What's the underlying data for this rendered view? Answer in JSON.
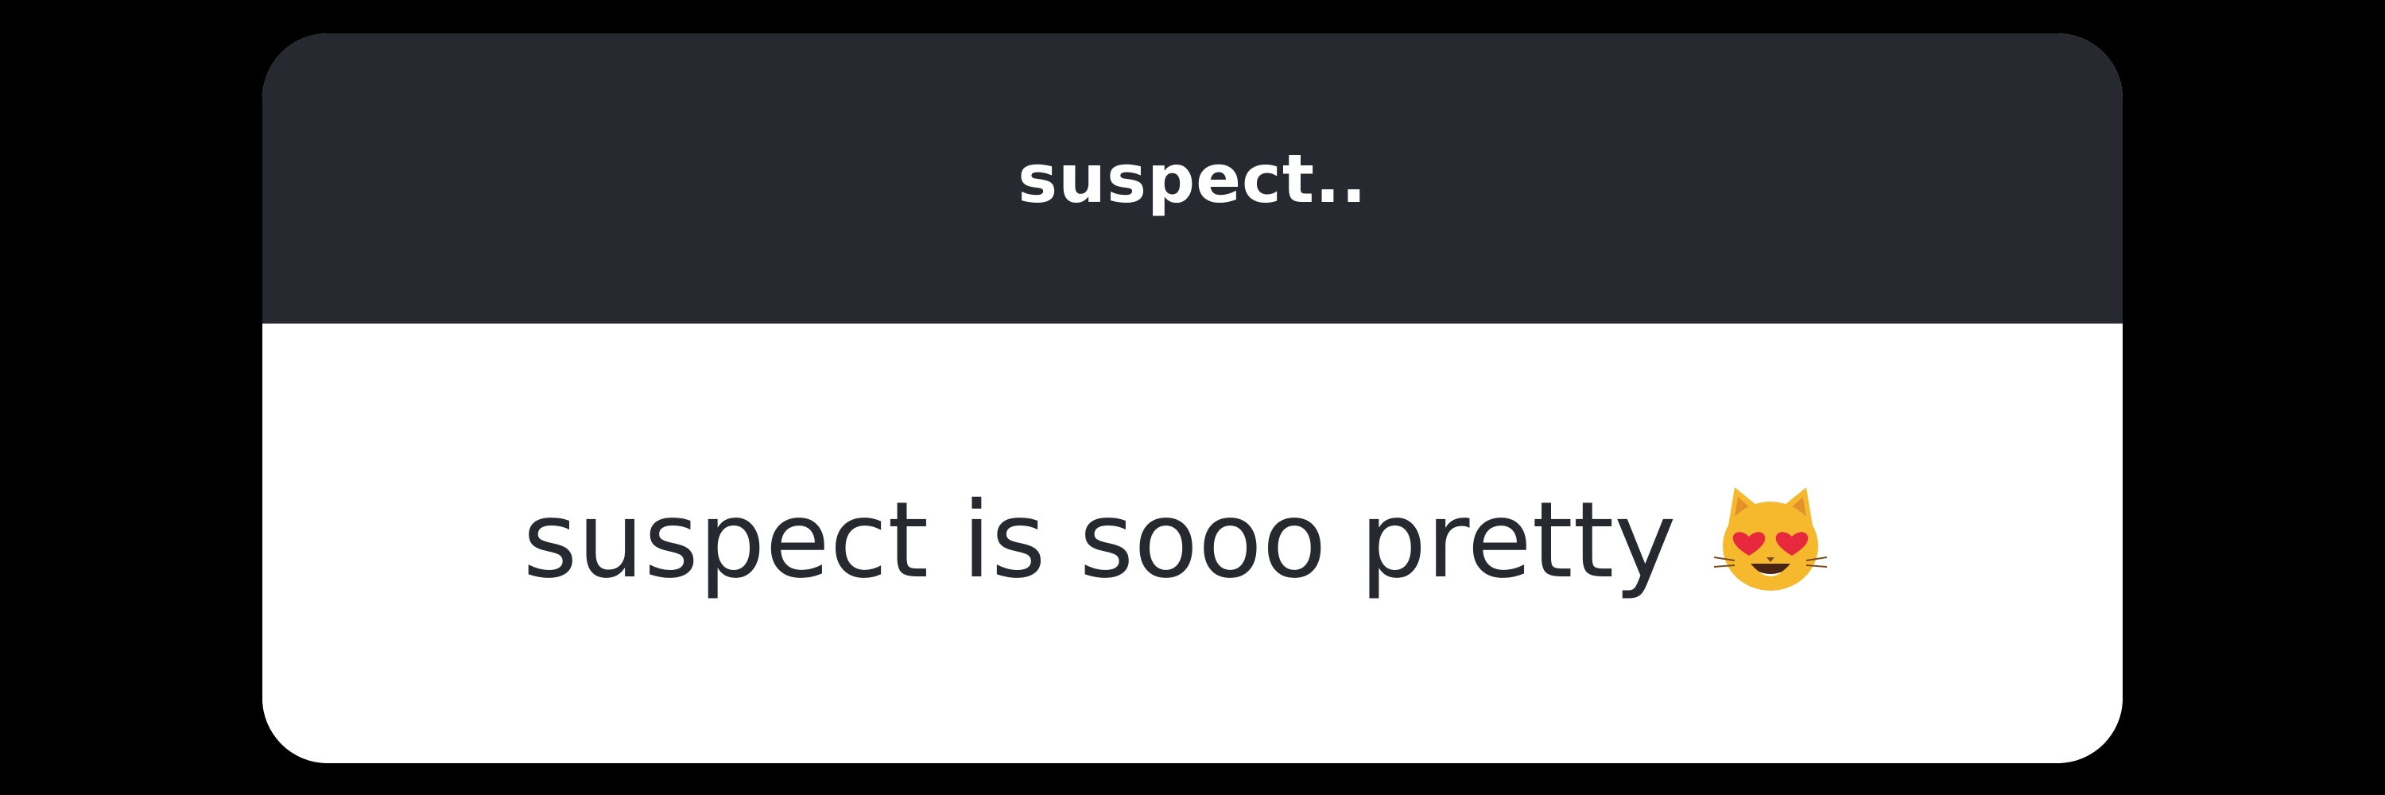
{
  "header": {
    "title": "suspect.."
  },
  "message": {
    "text": "suspect is sooo pretty",
    "emoji_icon": "smiling-cat-heart-eyes-icon"
  },
  "colors": {
    "background": "#000000",
    "header_background": "#262930",
    "card_background": "#ffffff",
    "header_text": "#ffffff",
    "body_text": "#262930",
    "emoji_face": "#f6b92d",
    "emoji_heart": "#e8283c"
  }
}
